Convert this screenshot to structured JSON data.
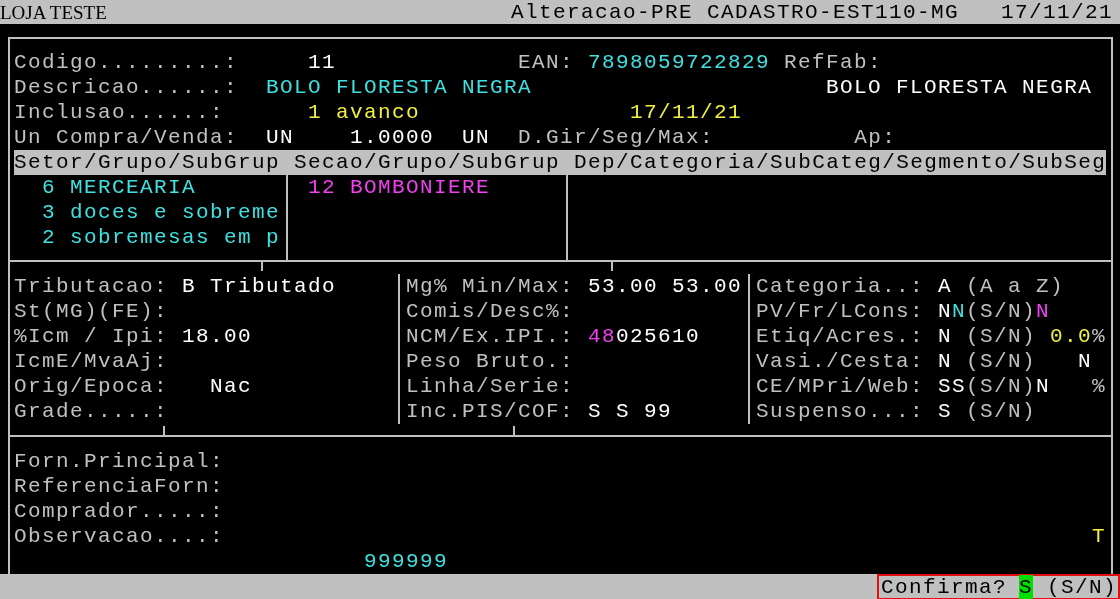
{
  "title_bar": {
    "store": "LOJA TESTE",
    "screen": "Alteracao-PRE CADASTRO-EST110-MG",
    "date": "17/11/21"
  },
  "identification": {
    "rows": [
      {
        "segments": [
          {
            "kind": "label",
            "text": "Codigo.........:"
          },
          {
            "kind": "value",
            "text": "11",
            "color": "#ffffff"
          },
          {
            "kind": "label",
            "text": "EAN:"
          },
          {
            "kind": "value",
            "text": "7898059722829",
            "color": "#40e0e0"
          },
          {
            "kind": "label",
            "text": "RefFab:"
          }
        ]
      },
      {
        "segments": [
          {
            "kind": "label",
            "text": "Descricao......:"
          },
          {
            "kind": "value",
            "text": "BOLO FLORESTA NEGRA",
            "color": "#40e0e0"
          },
          {
            "kind": "value",
            "text": "BOLO FLORESTA NEGRA",
            "color": "#ffffff"
          }
        ]
      },
      {
        "segments": [
          {
            "kind": "label",
            "text": "Inclusao......:"
          },
          {
            "kind": "value",
            "text": "1 avanco",
            "color": "#f0f040"
          },
          {
            "kind": "value",
            "text": "17/11/21",
            "color": "#f0f040"
          }
        ]
      },
      {
        "segments": [
          {
            "kind": "label",
            "text": "Un Compra/Venda:"
          },
          {
            "kind": "value",
            "text": "UN",
            "color": "#ffffff"
          },
          {
            "kind": "value",
            "text": "1.0000",
            "color": "#ffffff"
          },
          {
            "kind": "value",
            "text": "UN",
            "color": "#ffffff"
          },
          {
            "kind": "label",
            "text": "D.Gir/Seg/Max:"
          },
          {
            "kind": "label",
            "text": "Ap:"
          }
        ]
      }
    ]
  },
  "classification": {
    "headings": [
      "Setor/Grupo/SubGrup",
      "Secao/Grupo/SubGrup",
      "Dep/Categoria/SubCateg/Segmento/SubSeg"
    ],
    "setor": [
      {
        "text": "6 MERCEARIA",
        "color": "#40e0e0"
      },
      {
        "text": "3 doces e sobreme",
        "color": "#40e0e0"
      },
      {
        "text": "2 sobremesas em p",
        "color": "#40e0e0"
      }
    ],
    "secao": [
      {
        "text": "12 BOMBONIERE",
        "color": "#f040f0"
      }
    ]
  },
  "fiscal": {
    "rows": [
      {
        "cells": [
          [
            {
              "kind": "label",
              "text": "Tributacao:"
            },
            {
              "kind": "value",
              "text": "B Tributado",
              "color": "#ffffff"
            }
          ],
          [
            {
              "kind": "label",
              "text": "Mg% Min/Max:"
            },
            {
              "kind": "value",
              "text": "53.00 53.00",
              "color": "#ffffff"
            }
          ],
          [
            {
              "kind": "label",
              "text": "Categoria..:"
            },
            {
              "kind": "value",
              "text": "A",
              "color": "#ffffff"
            },
            {
              "kind": "hint",
              "text": "(A a Z)"
            }
          ]
        ]
      },
      {
        "cells": [
          [
            {
              "kind": "label",
              "text": "St(MG)(FE):"
            }
          ],
          [
            {
              "kind": "label",
              "text": "Comis/Desc%:"
            }
          ],
          [
            {
              "kind": "label",
              "text": "PV/Fr/LCons:"
            },
            {
              "kind": "value",
              "text": "N",
              "color": "#ffffff"
            },
            {
              "kind": "value",
              "text": "N",
              "color": "#40e0e0"
            },
            {
              "kind": "hint",
              "text": "(S/N)"
            },
            {
              "kind": "value",
              "text": "N",
              "color": "#f040f0"
            }
          ]
        ]
      },
      {
        "cells": [
          [
            {
              "kind": "label",
              "text": "%Icm / Ipi:"
            },
            {
              "kind": "value",
              "text": "18.00",
              "color": "#ffffff"
            }
          ],
          [
            {
              "kind": "label",
              "text": "NCM/Ex.IPI.:"
            },
            {
              "kind": "value",
              "text": "48",
              "color": "#f040f0"
            },
            {
              "kind": "value",
              "text": "025610",
              "color": "#ffffff"
            }
          ],
          [
            {
              "kind": "label",
              "text": "Etiq/Acres.:"
            },
            {
              "kind": "value",
              "text": "N",
              "color": "#ffffff"
            },
            {
              "kind": "hint",
              "text": "(S/N)"
            },
            {
              "kind": "value",
              "text": "0.0",
              "color": "#f0f040"
            },
            {
              "kind": "hint",
              "text": "%"
            }
          ]
        ]
      },
      {
        "cells": [
          [
            {
              "kind": "label",
              "text": "IcmE/MvaAj:"
            }
          ],
          [
            {
              "kind": "label",
              "text": "Peso Bruto.:"
            }
          ],
          [
            {
              "kind": "label",
              "text": "Vasi./Cesta:"
            },
            {
              "kind": "value",
              "text": "N",
              "color": "#ffffff"
            },
            {
              "kind": "hint",
              "text": "(S/N)"
            },
            {
              "kind": "value",
              "text": "N",
              "color": "#ffffff"
            }
          ]
        ]
      },
      {
        "cells": [
          [
            {
              "kind": "label",
              "text": "Orig/Epoca:"
            },
            {
              "kind": "value",
              "text": "Nac",
              "color": "#ffffff"
            }
          ],
          [
            {
              "kind": "label",
              "text": "Linha/Serie:"
            }
          ],
          [
            {
              "kind": "label",
              "text": "CE/MPri/Web:"
            },
            {
              "kind": "value",
              "text": "SS",
              "color": "#ffffff"
            },
            {
              "kind": "hint",
              "text": "(S/N)"
            },
            {
              "kind": "value",
              "text": "N",
              "color": "#ffffff"
            },
            {
              "kind": "hint",
              "text": "%"
            }
          ]
        ]
      },
      {
        "cells": [
          [
            {
              "kind": "label",
              "text": "Grade.....:"
            }
          ],
          [
            {
              "kind": "label",
              "text": "Inc.PIS/COF:"
            },
            {
              "kind": "value",
              "text": "S S 99",
              "color": "#ffffff"
            }
          ],
          [
            {
              "kind": "label",
              "text": "Suspenso...:"
            },
            {
              "kind": "value",
              "text": "S",
              "color": "#ffffff"
            },
            {
              "kind": "hint",
              "text": "(S/N)"
            }
          ]
        ]
      }
    ]
  },
  "supplier": {
    "rows": [
      {
        "segments": [
          {
            "kind": "label",
            "text": "Forn.Principal:"
          }
        ]
      },
      {
        "segments": [
          {
            "kind": "label",
            "text": "ReferenciaForn:"
          }
        ]
      },
      {
        "segments": [
          {
            "kind": "label",
            "text": "Comprador.....:"
          }
        ]
      },
      {
        "segments": [
          {
            "kind": "label",
            "text": "Observacao....:"
          },
          {
            "kind": "value",
            "text": "T",
            "color": "#f0f040"
          }
        ]
      },
      {
        "segments": [
          {
            "kind": "value",
            "text": "999999",
            "color": "#40e0e0"
          }
        ]
      }
    ]
  },
  "prompt": {
    "label": "Confirma?",
    "answer": "S",
    "options": "(S/N)"
  }
}
